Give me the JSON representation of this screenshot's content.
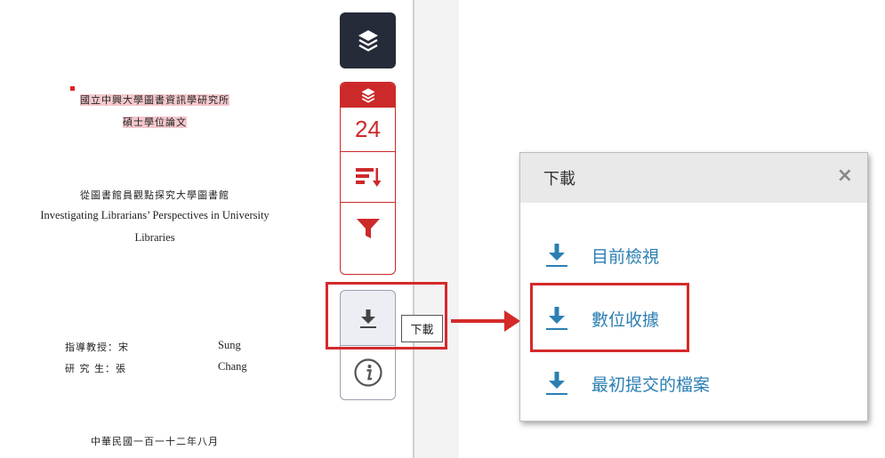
{
  "document": {
    "title_cn_line1": "國立中興大學圖書資訊學研究所",
    "title_cn_line2": "碩士學位論文",
    "thesis_cn": "從圖書館員觀點探究大學圖書館",
    "thesis_en_line1": "Investigating Librarians’ Perspectives in University",
    "thesis_en_line2": "Libraries",
    "advisor_label": "指導教授：宋",
    "advisor_en": "Sung",
    "student_label": "研 究 生：張",
    "student_en": "Chang",
    "date": "中華民國一百一十二年八月"
  },
  "toolbar": {
    "layers_icon": "layers-icon",
    "hit_count": "24",
    "sort_icon": "sort-descending-icon",
    "filter_icon": "filter-icon",
    "download_icon": "download-icon",
    "info_icon": "info-icon",
    "tooltip": "下載"
  },
  "dialog": {
    "title": "下載",
    "close": "×",
    "options": [
      {
        "label": "目前檢視"
      },
      {
        "label": "數位收據"
      },
      {
        "label": "最初提交的檔案"
      }
    ]
  },
  "colors": {
    "accent_red": "#cc2a2a",
    "dark_button": "#262b3a",
    "link_blue": "#2b7fb3"
  }
}
